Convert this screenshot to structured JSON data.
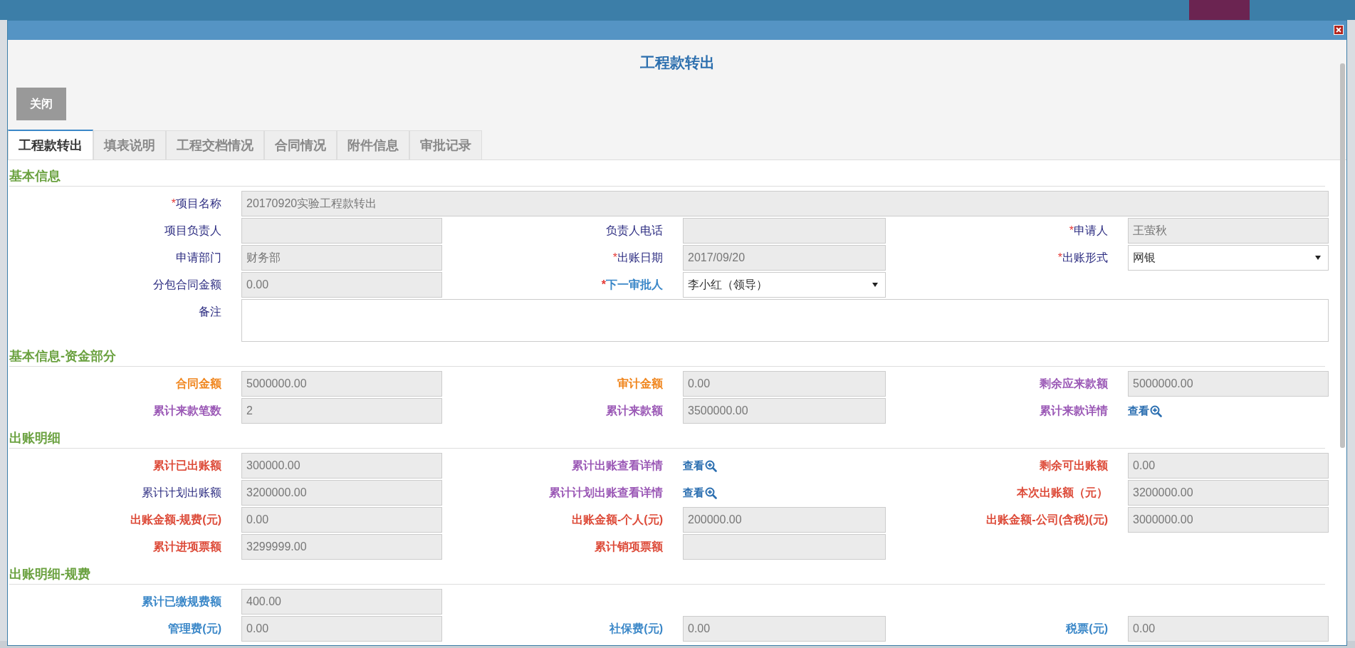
{
  "dialog": {
    "title": "工程款转出",
    "close_button": "关闭"
  },
  "tabs": [
    {
      "label": "工程款转出",
      "selected": true
    },
    {
      "label": "填表说明",
      "selected": false
    },
    {
      "label": "工程交档情况",
      "selected": false
    },
    {
      "label": "合同情况",
      "selected": false
    },
    {
      "label": "附件信息",
      "selected": false
    },
    {
      "label": "审批记录",
      "selected": false
    }
  ],
  "sections": [
    {
      "title": "基本信息",
      "rows": [
        [
          {
            "mark": "*",
            "label": "项目名称",
            "color": "#2b2b80",
            "kind": "wide",
            "value": "20170920实验工程款转出"
          }
        ],
        [
          {
            "label": "项目负责人",
            "color": "#2b2b80",
            "kind": "input"
          },
          {
            "label": "负责人电话",
            "color": "#2b2b80",
            "kind": "input"
          },
          {
            "mark": "*",
            "label": "申请人",
            "color": "#2b2b80",
            "kind": "input",
            "value": "王萤秋"
          }
        ],
        [
          {
            "label": "申请部门",
            "color": "#2b2b80",
            "kind": "input",
            "value": "财务部"
          },
          {
            "mark": "*",
            "label": "出账日期",
            "color": "#2b2b80",
            "kind": "input",
            "value": "2017/09/20"
          },
          {
            "mark": "*",
            "label": "出账形式",
            "color": "#2b2b80",
            "kind": "select",
            "value": "网银"
          }
        ],
        [
          {
            "label": "分包合同金额",
            "color": "#2b2b80",
            "kind": "input",
            "value": "0.00"
          },
          {
            "mark": "*",
            "label": "下一审批人",
            "color": "#3a87c8",
            "bold": true,
            "kind": "select",
            "value": "李小红（领导）"
          }
        ],
        [
          {
            "label": "备注",
            "color": "#2b2b80",
            "kind": "textarea"
          }
        ]
      ]
    },
    {
      "title": "基本信息-资金部分",
      "rows": [
        [
          {
            "label": "合同金额",
            "color": "#f0861e",
            "bold": true,
            "kind": "input",
            "value": "5000000.00"
          },
          {
            "label": "审计金额",
            "color": "#f0861e",
            "bold": true,
            "kind": "input",
            "value": "0.00"
          },
          {
            "label": "剩余应来款额",
            "color": "#9b59b6",
            "bold": true,
            "kind": "input",
            "value": "5000000.00"
          }
        ],
        [
          {
            "label": "累计来款笔数",
            "color": "#9b59b6",
            "bold": true,
            "kind": "input",
            "value": "2"
          },
          {
            "label": "累计来款额",
            "color": "#9b59b6",
            "bold": true,
            "kind": "input",
            "value": "3500000.00"
          },
          {
            "label": "累计来款详情",
            "color": "#9b59b6",
            "bold": true,
            "kind": "link",
            "value": "查看"
          }
        ]
      ]
    },
    {
      "title": "出账明细",
      "rows": [
        [
          {
            "label": "累计已出账额",
            "color": "#dd4b39",
            "bold": true,
            "kind": "input",
            "value": "300000.00"
          },
          {
            "label": "累计出账查看详情",
            "color": "#9b59b6",
            "bold": true,
            "kind": "link",
            "value": "查看"
          },
          {
            "label": "剩余可出账额",
            "color": "#dd4b39",
            "bold": true,
            "kind": "input",
            "value": "0.00"
          }
        ],
        [
          {
            "label": "累计计划出账额",
            "color": "#2b2b80",
            "kind": "input",
            "value": "3200000.00"
          },
          {
            "label": "累计计划出账查看详情",
            "color": "#9b59b6",
            "bold": true,
            "kind": "link",
            "value": "查看"
          },
          {
            "label": "本次出账额（元）",
            "color": "#dd4b39",
            "bold": true,
            "kind": "input",
            "value": "3200000.00"
          }
        ],
        [
          {
            "label": "出账金额-规费(元)",
            "color": "#dd4b39",
            "bold": true,
            "kind": "input",
            "value": "0.00"
          },
          {
            "label": "出账金额-个人(元)",
            "color": "#dd4b39",
            "bold": true,
            "kind": "input",
            "value": "200000.00"
          },
          {
            "label": "出账金额-公司(含税)(元)",
            "color": "#dd4b39",
            "bold": true,
            "kind": "input",
            "value": "3000000.00"
          }
        ],
        [
          {
            "label": "累计进项票额",
            "color": "#dd4b39",
            "bold": true,
            "kind": "input",
            "value": "3299999.00"
          },
          {
            "label": "累计销项票额",
            "color": "#dd4b39",
            "bold": true,
            "kind": "input"
          }
        ]
      ]
    },
    {
      "title": "出账明细-规费",
      "rows": [
        [
          {
            "label": "累计已缴规费额",
            "color": "#3a87c8",
            "bold": true,
            "kind": "input",
            "value": "400.00"
          }
        ],
        [
          {
            "label": "管理费(元)",
            "color": "#3a87c8",
            "bold": true,
            "kind": "input",
            "value": "0.00"
          },
          {
            "label": "社保费(元)",
            "color": "#3a87c8",
            "bold": true,
            "kind": "input",
            "value": "0.00"
          },
          {
            "label": "税票(元)",
            "color": "#3a87c8",
            "bold": true,
            "kind": "input",
            "value": "0.00"
          }
        ]
      ]
    }
  ]
}
